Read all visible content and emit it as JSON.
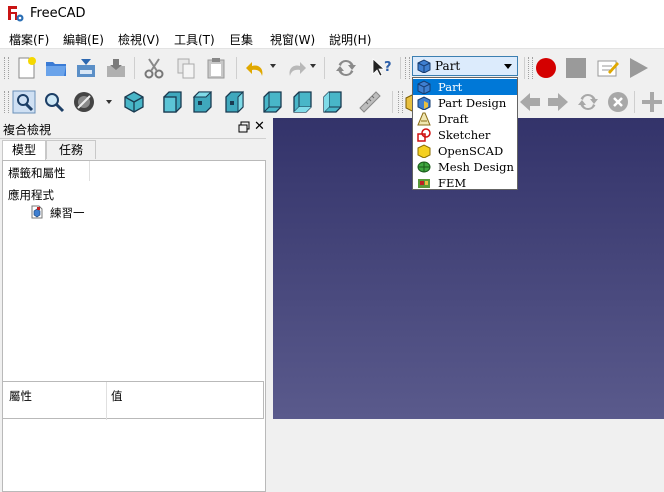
{
  "window": {
    "title": "FreeCAD",
    "logo_icon": "freecad-logo-icon"
  },
  "menu": {
    "items": [
      "檔案(F)",
      "編輯(E)",
      "檢視(V)",
      "工具(T)",
      "巨集",
      "視窗(W)",
      "說明(H)"
    ]
  },
  "toolbar": {
    "workbench_selected": "Part",
    "row1_icons": [
      "new-document-icon",
      "open-icon",
      "save-icon",
      "save-as-icon",
      "cut-icon",
      "copy-icon",
      "paste-icon",
      "undo-icon",
      "redo-icon",
      "refresh-icon",
      "whats-this-icon",
      "macro-record-icon",
      "macro-stop-icon",
      "macro-edit-icon",
      "macro-run-icon"
    ],
    "row2_icons": [
      "fit-all-icon",
      "fit-selection-icon",
      "draw-style-icon",
      "isometric-view-icon",
      "front-view-icon",
      "top-view-icon",
      "right-view-icon",
      "rear-view-icon",
      "bottom-view-icon",
      "left-view-icon",
      "measure-icon"
    ]
  },
  "workbench_dropdown": {
    "items": [
      {
        "label": "Part",
        "icon": "part-icon",
        "selected": true
      },
      {
        "label": "Part Design",
        "icon": "part-design-icon",
        "selected": false
      },
      {
        "label": "Draft",
        "icon": "draft-icon",
        "selected": false
      },
      {
        "label": "Sketcher",
        "icon": "sketcher-icon",
        "selected": false
      },
      {
        "label": "OpenSCAD",
        "icon": "openscad-icon",
        "selected": false
      },
      {
        "label": "Mesh Design",
        "icon": "mesh-design-icon",
        "selected": false
      },
      {
        "label": "FEM",
        "icon": "fem-icon",
        "selected": false
      }
    ]
  },
  "combo_view": {
    "title": "複合檢視",
    "tabs": [
      "模型",
      "任務"
    ],
    "tree_header": "標籤和屬性",
    "tree_root": "應用程式",
    "document": "練習一",
    "property_headers": [
      "屬性",
      "值"
    ]
  },
  "colors": {
    "viewport_top": "#33336a",
    "viewport_bottom": "#5a5a8c",
    "selection": "#0078d7",
    "macro_record": "#d40000"
  }
}
